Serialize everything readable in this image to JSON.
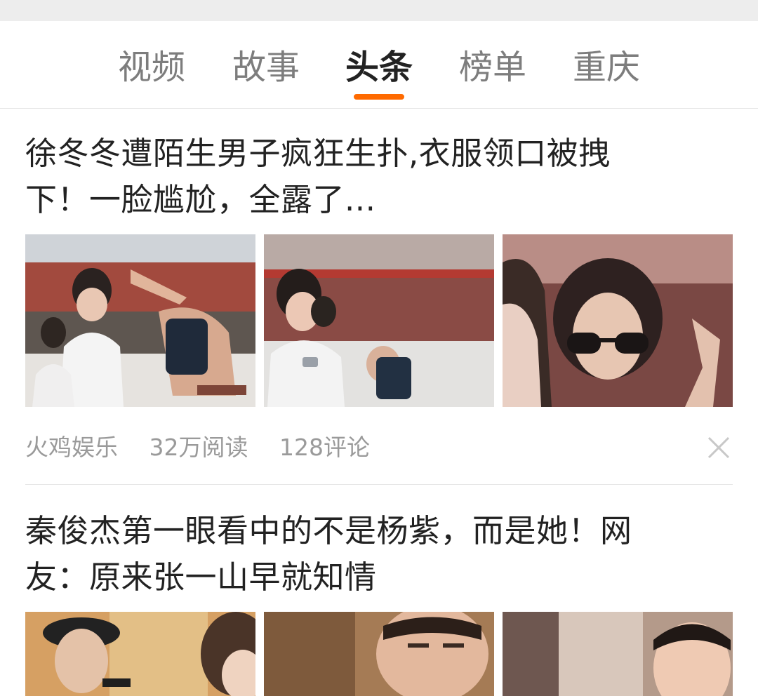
{
  "tabs": [
    {
      "label": "视频"
    },
    {
      "label": "故事"
    },
    {
      "label": "头条",
      "active": true
    },
    {
      "label": "榜单"
    },
    {
      "label": "重庆"
    }
  ],
  "accent_color": "#ff6a00",
  "articles": [
    {
      "title_line1": "徐冬冬遭陌生男子疯狂生扑,衣服领口被拽",
      "title_line2": "下！一脸尴尬，全露了...",
      "source": "火鸡娱乐",
      "reads": "32万阅读",
      "comments": "128评论",
      "close_icon": "close-icon"
    },
    {
      "title_line1": "秦俊杰第一眼看中的不是杨紫，而是她！网",
      "title_line2": "友：原来张一山早就知情"
    }
  ]
}
